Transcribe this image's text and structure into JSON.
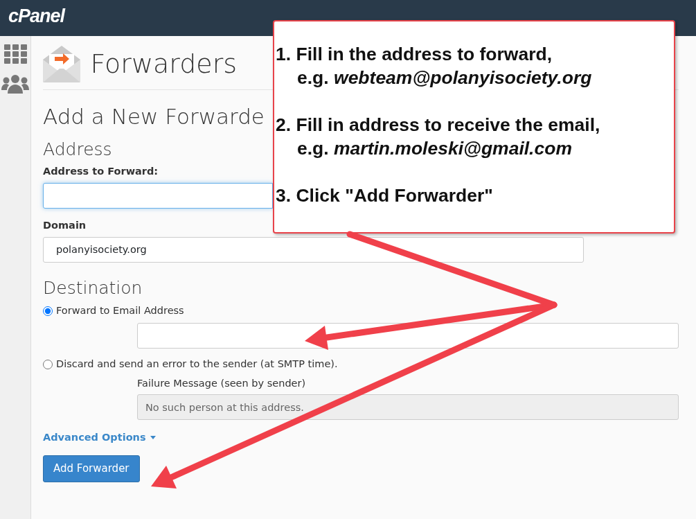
{
  "brand": "cPanel",
  "page_title": "Forwarders",
  "section_title": "Add a New Forwarde",
  "address": {
    "heading": "Address",
    "label": "Address to Forward:",
    "focused": true
  },
  "domain": {
    "label": "Domain",
    "value": "polanyisociety.org"
  },
  "destination": {
    "heading": "Destination",
    "options": [
      {
        "label": "Forward to Email Address",
        "selected": true
      },
      {
        "label": "Discard and send an error to the sender (at SMTP time).",
        "selected": false
      }
    ],
    "failure_label": "Failure Message (seen by sender)",
    "failure_value": "No such person at this address.",
    "failure_disabled": true
  },
  "advanced_link": "Advanced Options",
  "submit": "Add Forwarder",
  "callout": {
    "steps": [
      {
        "text": "1. Fill in the address to forward,",
        "example": "e.g. *webteam@polanyisociety.org*"
      },
      {
        "text": "2. Fill in address to receive the email,",
        "example": "e.g. *martin.moleski@gmail.com*"
      },
      {
        "text": "3. Click \"Add Forwarder\""
      }
    ]
  }
}
